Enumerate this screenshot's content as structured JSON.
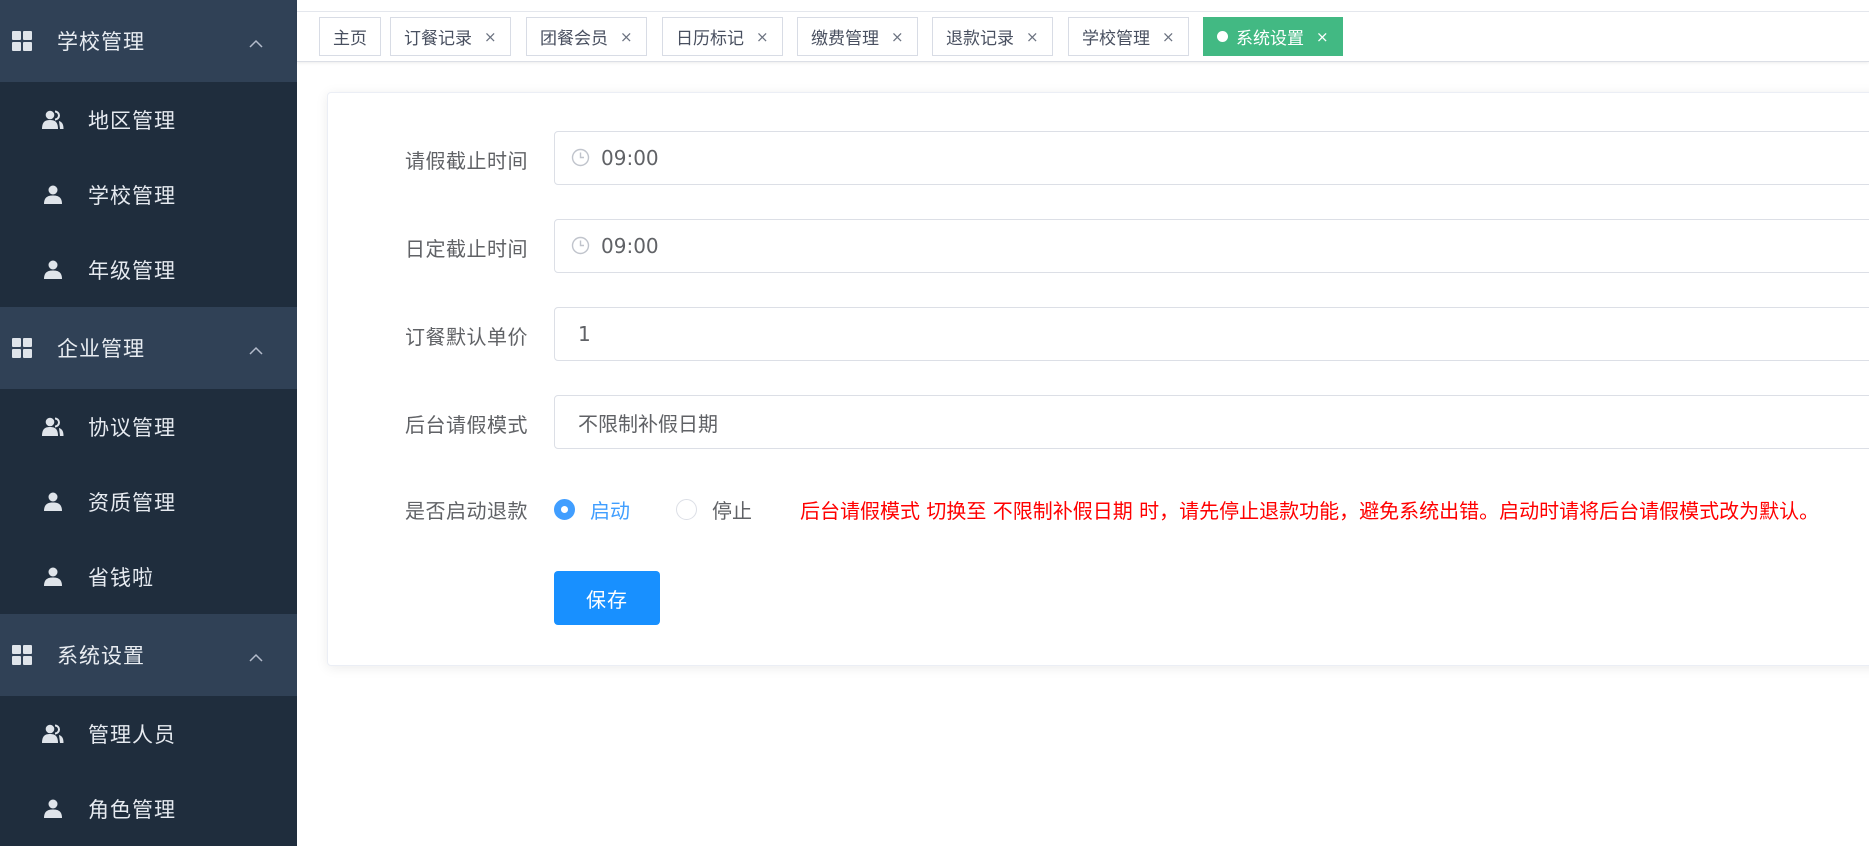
{
  "sidebar": {
    "groups": [
      {
        "label": "学校管理",
        "items": [
          {
            "label": "地区管理",
            "icon": "users-icon"
          },
          {
            "label": "学校管理",
            "icon": "user-icon"
          },
          {
            "label": "年级管理",
            "icon": "user-icon"
          }
        ]
      },
      {
        "label": "企业管理",
        "items": [
          {
            "label": "协议管理",
            "icon": "users-icon"
          },
          {
            "label": "资质管理",
            "icon": "user-icon"
          },
          {
            "label": "省钱啦",
            "icon": "user-icon"
          }
        ]
      },
      {
        "label": "系统设置",
        "items": [
          {
            "label": "管理人员",
            "icon": "users-icon"
          },
          {
            "label": "角色管理",
            "icon": "user-icon"
          }
        ]
      }
    ]
  },
  "tabs": [
    {
      "label": "主页",
      "closable": false
    },
    {
      "label": "订餐记录",
      "closable": true
    },
    {
      "label": "团餐会员",
      "closable": true
    },
    {
      "label": "日历标记",
      "closable": true
    },
    {
      "label": "缴费管理",
      "closable": true
    },
    {
      "label": "退款记录",
      "closable": true
    },
    {
      "label": "学校管理",
      "closable": true
    },
    {
      "label": "系统设置",
      "closable": true,
      "active": true
    }
  ],
  "tab_close_glyph": "×",
  "form": {
    "leave_deadline": {
      "label": "请假截止时间",
      "value": "09:00"
    },
    "daily_deadline": {
      "label": "日定截止时间",
      "value": "09:00"
    },
    "default_price": {
      "label": "订餐默认单价",
      "value": "1"
    },
    "leave_mode": {
      "label": "后台请假模式",
      "value": "不限制补假日期"
    },
    "refund": {
      "label": "是否启动退款",
      "options": [
        {
          "label": "启动",
          "checked": true
        },
        {
          "label": "停止",
          "checked": false
        }
      ],
      "warning": "后台请假模式 切换至 不限制补假日期 时，请先停止退款功能，避免系统出错。启动时请将后台请假模式改为默认。"
    },
    "save_label": "保存"
  },
  "colors": {
    "sidebar_bg": "#1f2d3d",
    "group_bg": "#304156",
    "active_tab": "#42b983",
    "primary": "#1890ff",
    "radio_checked": "#409eff",
    "warning": "#ff0000"
  }
}
